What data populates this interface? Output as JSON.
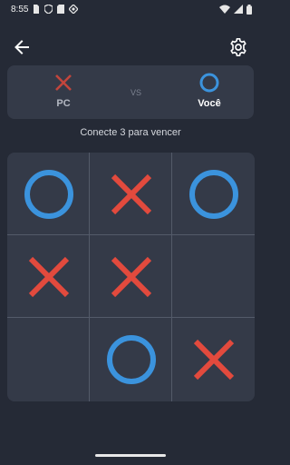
{
  "status_bar": {
    "time": "8:55",
    "icons": [
      "sim-card-icon",
      "privacy-shield-icon",
      "sd-card-icon",
      "diamond-icon",
      "wifi-icon",
      "signal-icon",
      "battery-icon"
    ]
  },
  "toolbar": {
    "back_icon": "arrow-left-icon",
    "settings_icon": "gear-icon"
  },
  "score": {
    "pc": {
      "label": "PC",
      "mark": "X"
    },
    "vs": "VS",
    "you": {
      "label": "Você",
      "mark": "O"
    }
  },
  "hint": "Conecte 3 para vencer",
  "board": {
    "cells": [
      "O",
      "X",
      "O",
      "X",
      "X",
      "",
      "",
      "O",
      "X"
    ]
  },
  "colors": {
    "background": "#252a36",
    "panel": "#343a48",
    "x_color": "#e24a3d",
    "o_color": "#3b93dd",
    "grid": "#535a69"
  }
}
